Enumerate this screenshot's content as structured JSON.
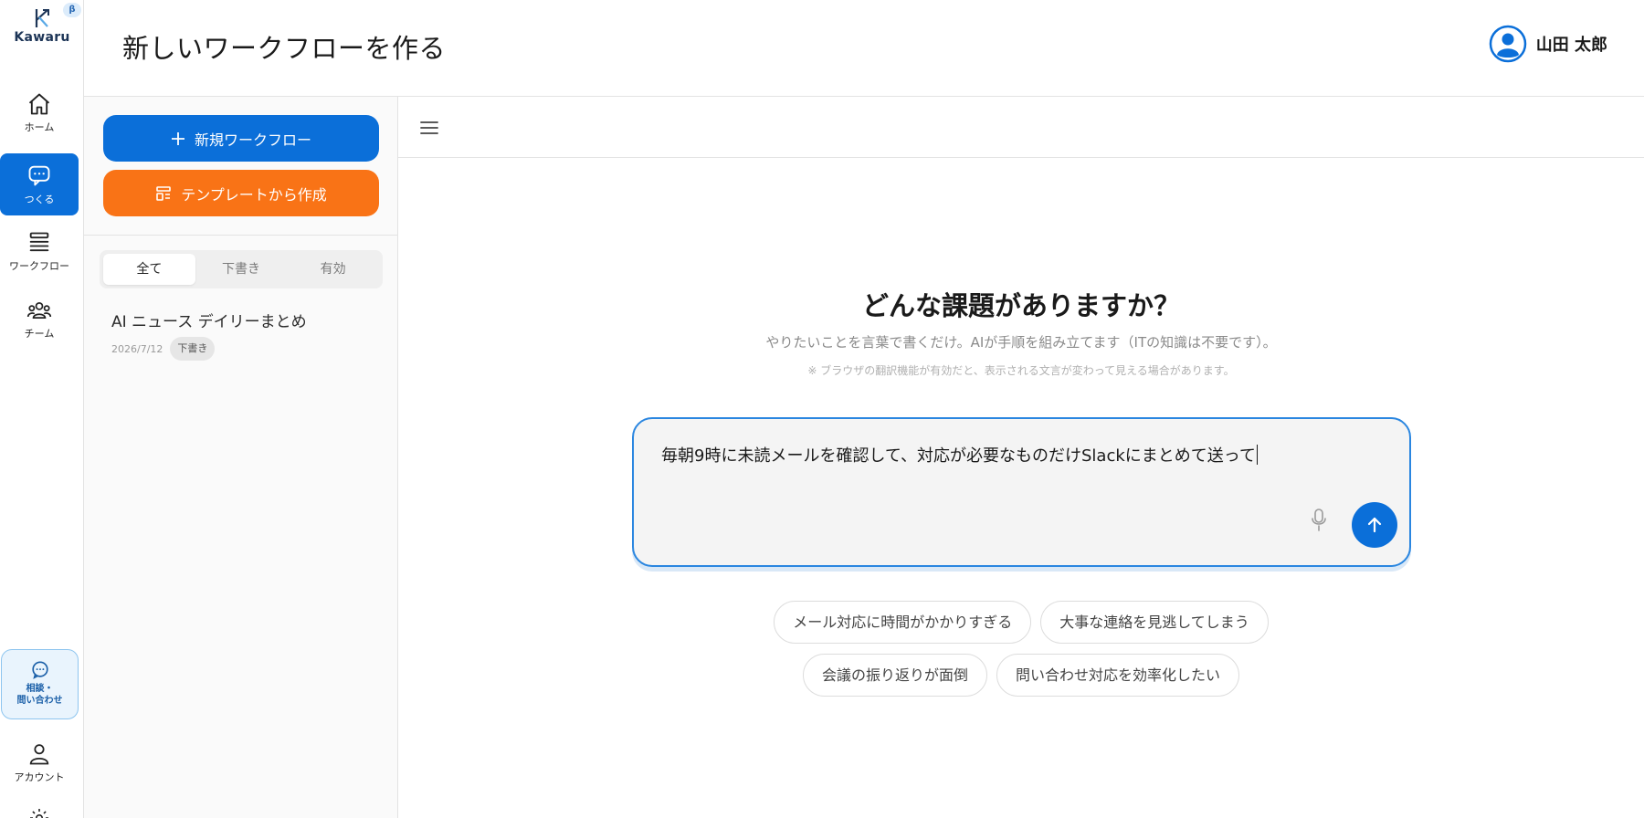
{
  "app": {
    "logo_text": "Kawaru",
    "beta_badge": "β"
  },
  "nav": {
    "items": [
      {
        "label": "ホーム",
        "icon": "home-icon"
      },
      {
        "label": "つくる",
        "icon": "chat-icon",
        "active": true
      },
      {
        "label": "ワークフロー",
        "icon": "stack-icon"
      },
      {
        "label": "チーム",
        "icon": "team-icon"
      }
    ],
    "help_line1": "相談・",
    "help_line2": "問い合わせ",
    "account_label": "アカウント"
  },
  "header": {
    "title": "新しいワークフローを作る",
    "user_name": "山田 太郎"
  },
  "panel": {
    "new_button": "新規ワークフロー",
    "template_button": "テンプレートから作成",
    "tabs": [
      "全て",
      "下書き",
      "有効"
    ],
    "active_tab": "全て",
    "workflows": [
      {
        "title": "AI ニュース デイリーまとめ",
        "date": "2026/7/12",
        "status": "下書き"
      }
    ]
  },
  "main": {
    "heading": "どんな課題がありますか？",
    "subtitle": "やりたいことを言葉で書くだけ。AIが手順を組み立てます（ITの知識は不要です）。",
    "note": "※ ブラウザの翻訳機能が有効だと、表示される文言が変わって見える場合があります。",
    "input_value": "毎朝9時に未読メールを確認して、対応が必要なものだけSlackにまとめて送って",
    "suggestions": [
      [
        "メール対応に時間がかかりすぎる",
        "大事な連絡を見逃してしまう"
      ],
      [
        "会議の振り返りが面倒",
        "問い合わせ対応を効率化したい"
      ]
    ]
  },
  "colors": {
    "primary": "#0b6fd9",
    "accent_orange": "#f97316",
    "input_border": "#2a86e0"
  }
}
